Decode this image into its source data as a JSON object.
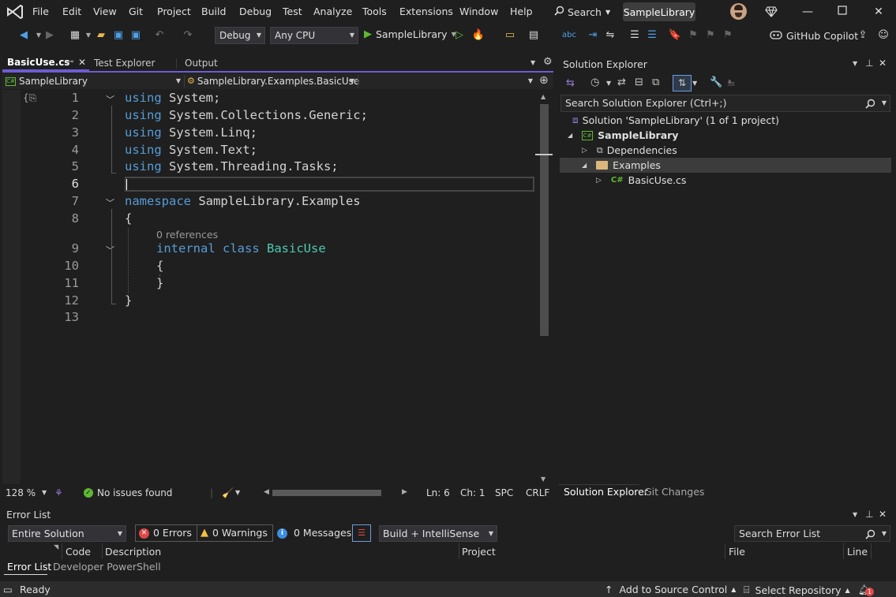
{
  "menu": [
    "File",
    "Edit",
    "View",
    "Git",
    "Project",
    "Build",
    "Debug",
    "Test",
    "Analyze",
    "Tools",
    "Extensions",
    "Window",
    "Help"
  ],
  "search_label": "Search",
  "solution_name": "SampleLibrary",
  "toolbar": {
    "config": "Debug",
    "platform": "Any CPU",
    "start_target": "SampleLibrary",
    "copilot": "GitHub Copilot"
  },
  "doc_tabs": [
    {
      "label": "BasicUse.cs",
      "active": true
    },
    {
      "label": "Test Explorer",
      "active": false
    },
    {
      "label": "Output",
      "active": false
    }
  ],
  "navbar": {
    "project": "SampleLibrary",
    "type": "SampleLibrary.Examples.BasicUse"
  },
  "editor": {
    "line_numbers": [
      "1",
      "2",
      "3",
      "4",
      "5",
      "6",
      "7",
      "8",
      "9",
      "10",
      "11",
      "12",
      "13"
    ],
    "current_line": "6",
    "lines": {
      "l1_kw": "using",
      "l1_rest": " System;",
      "l2_kw": "using",
      "l2_rest": " System.Collections.Generic;",
      "l3_kw": "using",
      "l3_rest": " System.Linq;",
      "l4_kw": "using",
      "l4_rest": " System.Text;",
      "l5_kw": "using",
      "l5_rest": " System.Threading.Tasks;",
      "l7_kw": "namespace",
      "l7_rest": " SampleLibrary.Examples",
      "l8": "{",
      "l9_kw1": "internal",
      "l9_kw2": "class",
      "l9_type": "BasicUse",
      "l10": "{",
      "l11": "}",
      "l12": "}"
    },
    "codelens": "0 references"
  },
  "editor_status": {
    "zoom": "128 %",
    "issues": "No issues found",
    "ln": "Ln: 6",
    "ch": "Ch: 1",
    "spc": "SPC",
    "eol": "CRLF"
  },
  "solution_explorer": {
    "title": "Solution Explorer",
    "search_placeholder": "Search Solution Explorer (Ctrl+;)",
    "solution_node": "Solution 'SampleLibrary' (1 of 1 project)",
    "project_node": "SampleLibrary",
    "dependencies": "Dependencies",
    "examples_folder": "Examples",
    "file": "BasicUse.cs",
    "cs_badge": "C#",
    "bottom_tabs": [
      "Solution Explorer",
      "Git Changes"
    ]
  },
  "error_list": {
    "title": "Error List",
    "scope": "Entire Solution",
    "errors": "0 Errors",
    "warnings": "0 Warnings",
    "messages": "0 Messages",
    "source": "Build + IntelliSense",
    "search_placeholder": "Search Error List",
    "columns": [
      "Code",
      "Description",
      "Project",
      "File",
      "Line"
    ],
    "bottom_tabs": [
      "Error List",
      "Developer PowerShell"
    ]
  },
  "statusbar": {
    "ready": "Ready",
    "source_control": "Add to Source Control",
    "repository": "Select Repository",
    "notif_count": "1"
  },
  "colors": {
    "accent": "#6c5dd3",
    "keyword": "#569cd6",
    "type": "#4ec9b0",
    "run_green": "#5fb832"
  }
}
